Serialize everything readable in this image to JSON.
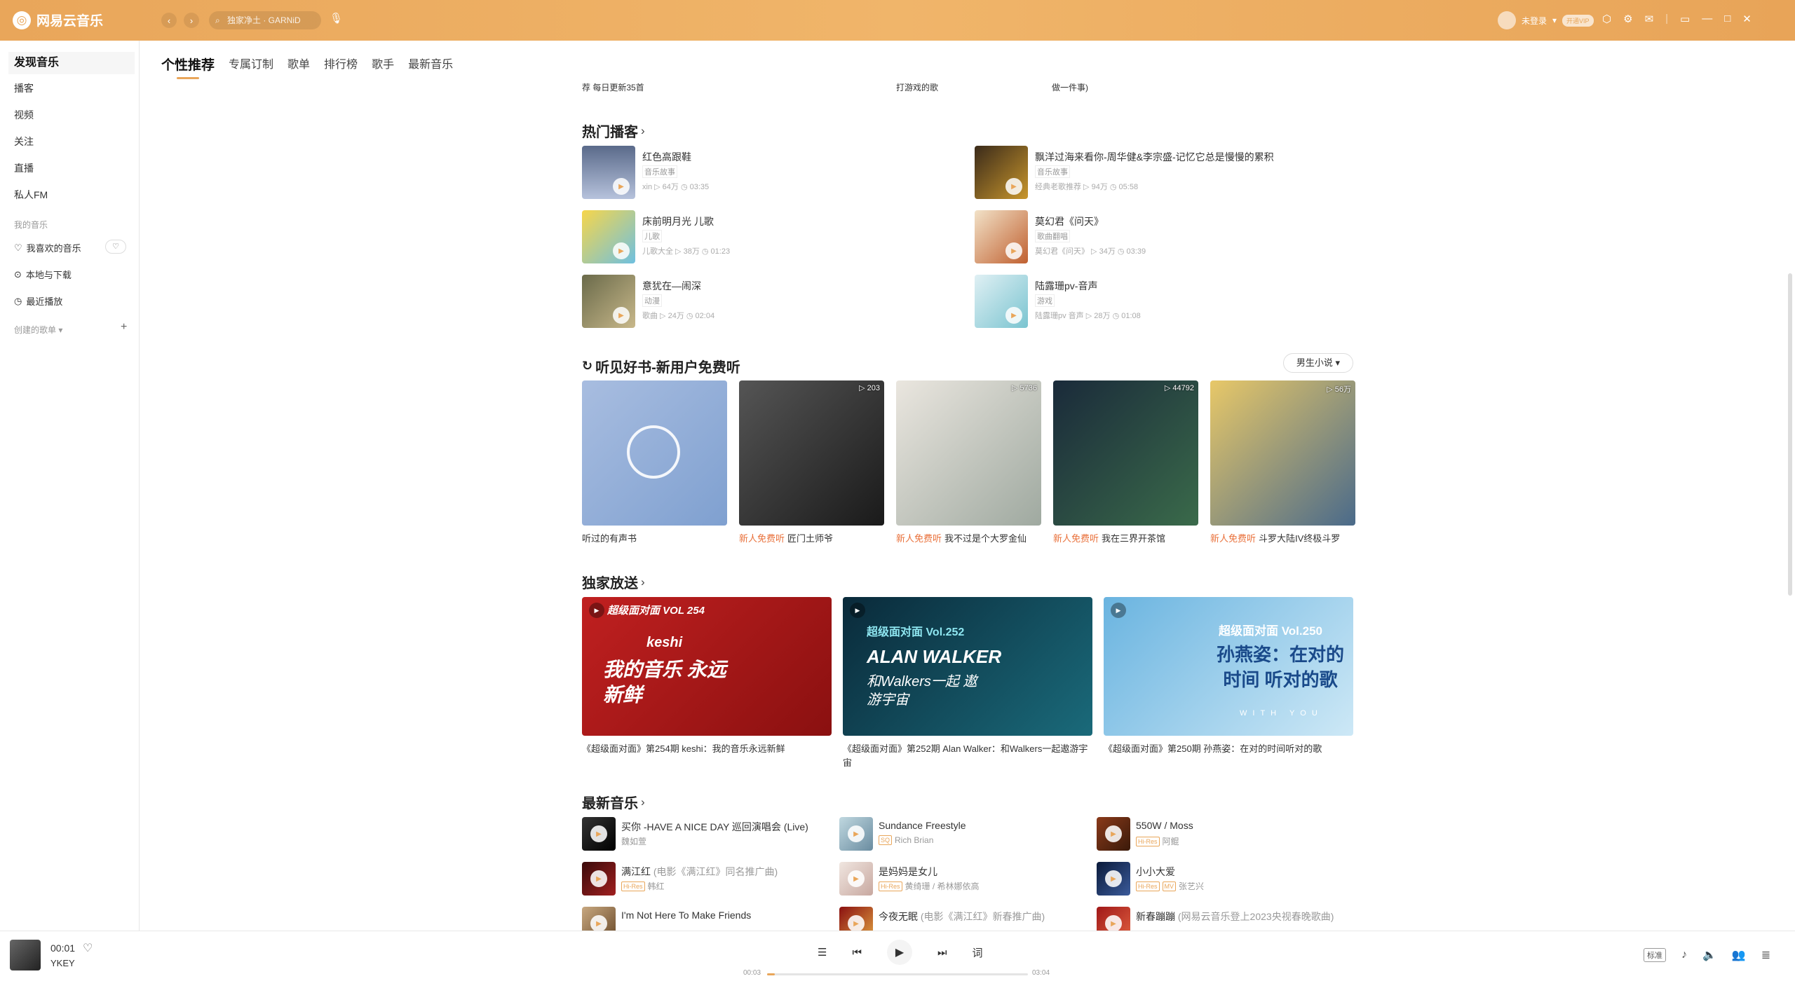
{
  "app": {
    "name": "网易云音乐",
    "search_placeholder": "独家净土 · GARNiD",
    "user": "未登录",
    "vip_label": "开通VIP"
  },
  "colors": {
    "accent": "#e9a65a",
    "new_tag": "#e9703a"
  },
  "sidebar": {
    "items": [
      "发现音乐",
      "播客",
      "视频",
      "关注",
      "直播",
      "私人FM"
    ],
    "my_music_label": "我的音乐",
    "my_items": [
      "我喜欢的音乐",
      "本地与下载",
      "最近播放"
    ],
    "created_label": "创建的歌单"
  },
  "tabs": [
    "个性推荐",
    "专属订制",
    "歌单",
    "排行榜",
    "歌手",
    "最新音乐"
  ],
  "prev_row": [
    "荐 每日更新35首",
    "打游戏的歌",
    "做一件事)"
  ],
  "hot_podcasts": {
    "title": "热门播客",
    "items": [
      {
        "title": "红色高跟鞋",
        "cat": "音乐故事",
        "author": "xin",
        "plays": "64万",
        "dur": "03:35"
      },
      {
        "title": "飘洋过海来看你-周华健&李宗盛-记忆它总是慢慢的累积",
        "cat": "音乐故事",
        "author": "经典老歌推荐",
        "plays": "94万",
        "dur": "05:58"
      },
      {
        "title": "床前明月光 儿歌",
        "cat": "儿歌",
        "author": "儿歌大全",
        "plays": "38万",
        "dur": "01:23"
      },
      {
        "title": "莫幻君《问天》",
        "cat": "歌曲翻唱",
        "author": "莫幻君《问天》",
        "plays": "34万",
        "dur": "03:39"
      },
      {
        "title": "意犹在—闹深",
        "cat": "动漫",
        "author": "歌曲",
        "plays": "24万",
        "dur": "02:04"
      },
      {
        "title": "陆露珊pv-音声",
        "cat": "游戏",
        "author": "陆露珊pv 音声",
        "plays": "28万",
        "dur": "01:08"
      }
    ]
  },
  "books": {
    "title": "听见好书-新用户免费听",
    "dropdown": "男生小说",
    "new_tag": "新人免费听",
    "items": [
      {
        "title": "听过的有声书",
        "count": ""
      },
      {
        "title": "匠门土师爷",
        "count": "203"
      },
      {
        "title": "我不过是个大罗金仙",
        "count": "5736"
      },
      {
        "title": "我在三界开茶馆",
        "count": "44792"
      },
      {
        "title": "斗罗大陆IV终极斗罗",
        "count": "56万"
      }
    ]
  },
  "exclusive": {
    "title": "独家放送",
    "items": [
      {
        "caption": "《超级面对面》第254期 keshi：我的音乐永远新鲜",
        "art_title": "我的音乐 永远新鲜",
        "art_tag": "超级面对面 VOL 254",
        "art_name": "keshi"
      },
      {
        "caption": "《超级面对面》第252期 Alan Walker：和Walkers一起遨游宇宙",
        "art_title": "ALAN WALKER",
        "art_tag": "超级面对面 Vol.252",
        "art_name": "和Walkers一起 遨游宇宙"
      },
      {
        "caption": "《超级面对面》第250期 孙燕姿：在对的时间听对的歌",
        "art_title": "孙燕姿：在对的时间 听对的歌",
        "art_tag": "超级面对面 Vol.250",
        "art_name": "WITH YOU"
      }
    ]
  },
  "new_music": {
    "title": "最新音乐",
    "items": [
      {
        "title": "买你 -HAVE A NICE DAY 巡回演唱会 (Live)",
        "sub": "",
        "artist": "魏如萱",
        "tags": []
      },
      {
        "title": "Sundance Freestyle",
        "sub": "",
        "artist": "Rich Brian",
        "tags": [
          "SQ"
        ]
      },
      {
        "title": "550W / Moss",
        "sub": "",
        "artist": "阿鲲",
        "tags": [
          "Hi-Res"
        ]
      },
      {
        "title": "满江红",
        "sub": "(电影《满江红》同名推广曲)",
        "artist": "韩红",
        "tags": [
          "Hi-Res"
        ]
      },
      {
        "title": "是妈妈是女儿",
        "sub": "",
        "artist": "黄绮珊 / 希林娜依高",
        "tags": [
          "Hi-Res"
        ]
      },
      {
        "title": "小小大爱",
        "sub": "",
        "artist": "张艺兴",
        "tags": [
          "Hi-Res",
          "MV"
        ]
      },
      {
        "title": "I'm Not Here To Make Friends",
        "sub": "",
        "artist": "",
        "tags": []
      },
      {
        "title": "今夜无眠",
        "sub": "(电影《满江红》新春推广曲)",
        "artist": "",
        "tags": []
      },
      {
        "title": "新春蹦蹦",
        "sub": "(网易云音乐登上2023央视春晚歌曲)",
        "artist": "",
        "tags": []
      }
    ]
  },
  "player": {
    "time": "00:01",
    "song": "YKEY",
    "elapsed": "00:03",
    "total": "03:04",
    "progress": 0.03,
    "quality": "标准"
  }
}
